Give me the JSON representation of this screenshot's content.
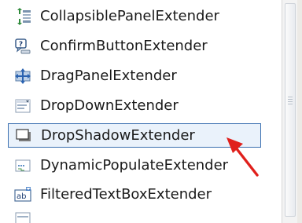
{
  "toolbox": {
    "items": [
      {
        "label": "CollapsiblePanelExtender",
        "icon": "collapsible-panel-icon"
      },
      {
        "label": "ConfirmButtonExtender",
        "icon": "confirm-button-icon"
      },
      {
        "label": "DragPanelExtender",
        "icon": "drag-panel-icon"
      },
      {
        "label": "DropDownExtender",
        "icon": "drop-down-icon"
      },
      {
        "label": "DropShadowExtender",
        "icon": "drop-shadow-icon",
        "selected": true
      },
      {
        "label": "DynamicPopulateExtender",
        "icon": "dynamic-populate-icon"
      },
      {
        "label": "FilteredTextBoxExtender",
        "icon": "filtered-textbox-icon"
      }
    ]
  },
  "colors": {
    "selection_border": "#3a6fb0",
    "selection_fill": "#eaf2fb",
    "annotation_arrow": "#e0201c"
  }
}
